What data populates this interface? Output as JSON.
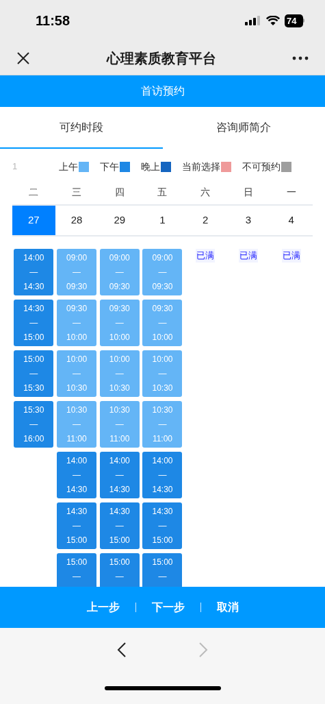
{
  "status_bar": {
    "time": "11:58",
    "battery": "74"
  },
  "nav": {
    "title": "心理素质教育平台"
  },
  "header": {
    "title": "首访预约"
  },
  "tabs": [
    {
      "label": "可约时段",
      "selected": true
    },
    {
      "label": "咨询师简介",
      "selected": false
    }
  ],
  "legend_note": "1",
  "legend": [
    {
      "label": "上午",
      "color": "#64b5f6"
    },
    {
      "label": "下午",
      "color": "#1e88e5"
    },
    {
      "label": "晚上",
      "color": "#1565c0"
    },
    {
      "label": "当前选择",
      "color": "#ef9a9a"
    },
    {
      "label": "不可预约",
      "color": "#9e9e9e"
    }
  ],
  "days": [
    {
      "weekday": "二",
      "date": "27",
      "selected": true,
      "slots": [
        {
          "kind": "afternoon",
          "start": "14:00",
          "dash": "—",
          "end": "14:30"
        },
        {
          "kind": "afternoon",
          "start": "14:30",
          "dash": "—",
          "end": "15:00"
        },
        {
          "kind": "afternoon",
          "start": "15:00",
          "dash": "—",
          "end": "15:30"
        },
        {
          "kind": "afternoon",
          "start": "15:30",
          "dash": "—",
          "end": "16:00"
        }
      ]
    },
    {
      "weekday": "三",
      "date": "28",
      "selected": false,
      "slots": [
        {
          "kind": "morning",
          "start": "09:00",
          "dash": "—",
          "end": "09:30"
        },
        {
          "kind": "morning",
          "start": "09:30",
          "dash": "—",
          "end": "10:00"
        },
        {
          "kind": "morning",
          "start": "10:00",
          "dash": "—",
          "end": "10:30"
        },
        {
          "kind": "morning",
          "start": "10:30",
          "dash": "—",
          "end": "11:00"
        },
        {
          "kind": "afternoon",
          "start": "14:00",
          "dash": "—",
          "end": "14:30"
        },
        {
          "kind": "afternoon",
          "start": "14:30",
          "dash": "—",
          "end": "15:00"
        },
        {
          "kind": "afternoon",
          "start": "15:00",
          "dash": "—"
        }
      ]
    },
    {
      "weekday": "四",
      "date": "29",
      "selected": false,
      "slots": [
        {
          "kind": "morning",
          "start": "09:00",
          "dash": "—",
          "end": "09:30"
        },
        {
          "kind": "morning",
          "start": "09:30",
          "dash": "—",
          "end": "10:00"
        },
        {
          "kind": "morning",
          "start": "10:00",
          "dash": "—",
          "end": "10:30"
        },
        {
          "kind": "morning",
          "start": "10:30",
          "dash": "—",
          "end": "11:00"
        },
        {
          "kind": "afternoon",
          "start": "14:00",
          "dash": "—",
          "end": "14:30"
        },
        {
          "kind": "afternoon",
          "start": "14:30",
          "dash": "—",
          "end": "15:00"
        },
        {
          "kind": "afternoon",
          "start": "15:00",
          "dash": "—"
        }
      ]
    },
    {
      "weekday": "五",
      "date": "1",
      "selected": false,
      "slots": [
        {
          "kind": "morning",
          "start": "09:00",
          "dash": "—",
          "end": "09:30"
        },
        {
          "kind": "morning",
          "start": "09:30",
          "dash": "—",
          "end": "10:00"
        },
        {
          "kind": "morning",
          "start": "10:00",
          "dash": "—",
          "end": "10:30"
        },
        {
          "kind": "morning",
          "start": "10:30",
          "dash": "—",
          "end": "11:00"
        },
        {
          "kind": "afternoon",
          "start": "14:00",
          "dash": "—",
          "end": "14:30"
        },
        {
          "kind": "afternoon",
          "start": "14:30",
          "dash": "—",
          "end": "15:00"
        },
        {
          "kind": "afternoon",
          "start": "15:00",
          "dash": "—"
        }
      ]
    },
    {
      "weekday": "六",
      "date": "2",
      "selected": false,
      "status": "已满"
    },
    {
      "weekday": "日",
      "date": "3",
      "selected": false,
      "status": "已满"
    },
    {
      "weekday": "一",
      "date": "4",
      "selected": false,
      "status": "已满"
    }
  ],
  "actions": [
    "上一步",
    "下一步",
    "取消"
  ],
  "browser": {
    "back_enabled": true,
    "forward_enabled": false
  }
}
